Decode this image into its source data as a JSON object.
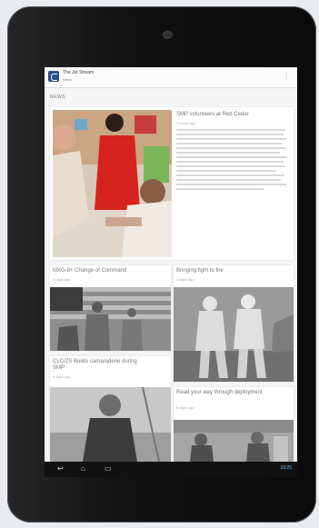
{
  "app": {
    "title": "The Jet Stream",
    "subtitle": "News",
    "overflow_glyph": "⋮"
  },
  "section_label": "NEWS",
  "featured": {
    "title": "SMP volunteers at Red Cedar",
    "date": "3 hours ago"
  },
  "cards": [
    {
      "title": "MXG-8+ Change of Command",
      "date": "3 days ago"
    },
    {
      "title": "Bringing fight to fire",
      "date": "4 days ago"
    },
    {
      "title": "CLC/ZS Builds camaraderie during SMP",
      "date": "5 days ago"
    },
    {
      "title": "Read your way through deployment",
      "date": "6 days ago"
    }
  ],
  "system": {
    "time": "10:25",
    "back_icon": "↩",
    "home_icon": "⌂",
    "recents_icon": "▭"
  }
}
